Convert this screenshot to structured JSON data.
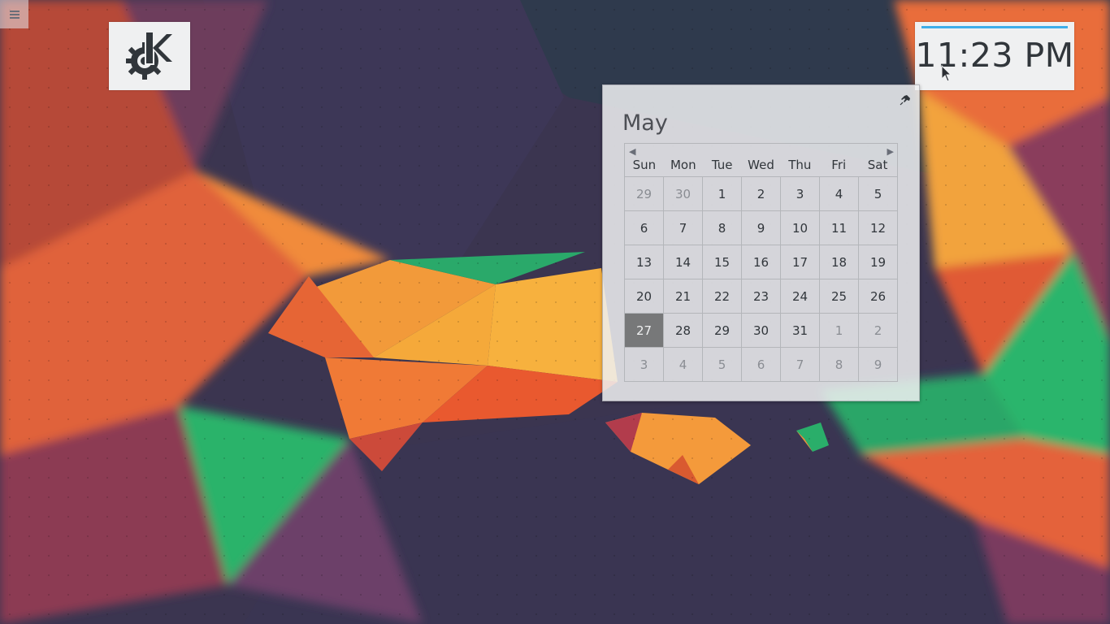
{
  "desktop": {
    "toolbox_icon": "hamburger-menu-icon",
    "launcher_icon": "kde-logo-icon"
  },
  "clock": {
    "time": "11:23 PM",
    "accent_color": "#3daee9"
  },
  "calendar": {
    "month": "May",
    "pin_icon": "pin-icon",
    "prev_icon": "triangle-left-icon",
    "next_icon": "triangle-right-icon",
    "weekdays": [
      "Sun",
      "Mon",
      "Tue",
      "Wed",
      "Thu",
      "Fri",
      "Sat"
    ],
    "weeks": [
      [
        "29",
        "30",
        "1",
        "2",
        "3",
        "4",
        "5"
      ],
      [
        "6",
        "7",
        "8",
        "9",
        "10",
        "11",
        "12"
      ],
      [
        "13",
        "14",
        "15",
        "16",
        "17",
        "18",
        "19"
      ],
      [
        "20",
        "21",
        "22",
        "23",
        "24",
        "25",
        "26"
      ],
      [
        "27",
        "28",
        "29",
        "30",
        "31",
        "1",
        "2"
      ],
      [
        "3",
        "4",
        "5",
        "6",
        "7",
        "8",
        "9"
      ]
    ],
    "today": "27",
    "today_color": "#777879"
  }
}
